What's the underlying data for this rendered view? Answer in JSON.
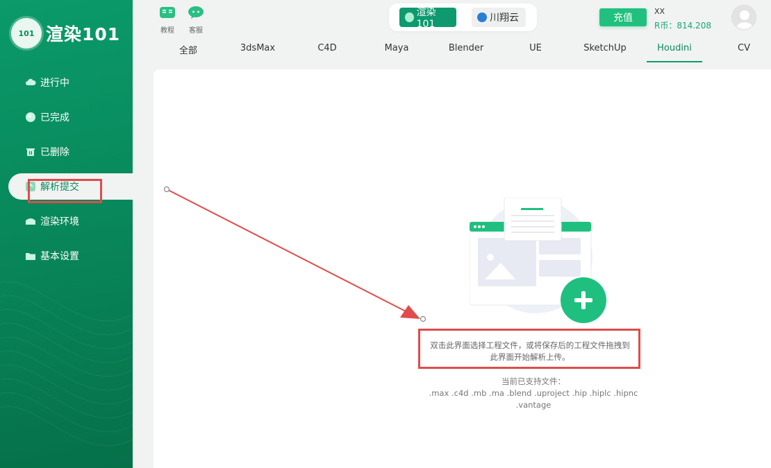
{
  "logo": {
    "badge": "101",
    "text": "渲染101"
  },
  "sidebar": {
    "items": [
      {
        "label": "进行中",
        "icon": "cloud-icon"
      },
      {
        "label": "已完成",
        "icon": "check-circle-icon"
      },
      {
        "label": "已删除",
        "icon": "trash-icon"
      },
      {
        "label": "解析提交",
        "icon": "submit-icon",
        "active": true
      },
      {
        "label": "渲染环境",
        "icon": "environment-icon"
      },
      {
        "label": "基本设置",
        "icon": "folder-icon"
      }
    ]
  },
  "topbar": {
    "tutorial_label": "教程",
    "service_label": "客服",
    "switch_active": "渲染101",
    "switch_other": "川翔云",
    "recharge_label": "充值",
    "user_name": "XX",
    "user_coin": "R币：814.208"
  },
  "tabs": [
    "全部",
    "3dsMax",
    "C4D",
    "Maya",
    "Blender",
    "UE",
    "SketchUp",
    "Houdini",
    "CV"
  ],
  "active_tab": "Houdini",
  "content": {
    "hint_line1": "双击此界面选择工程文件，或将保存后的工程文件拖拽到",
    "hint_line2": "此界面开始解析上传。",
    "support_title": "当前已支持文件：",
    "support_line1": ".max .c4d .mb .ma .blend .uproject .hip .hiplc .hipnc",
    "support_line2": ".vantage"
  },
  "colors": {
    "brand": "#0e9a6e",
    "accent": "#21c07f",
    "annotation": "#e14b4b"
  }
}
